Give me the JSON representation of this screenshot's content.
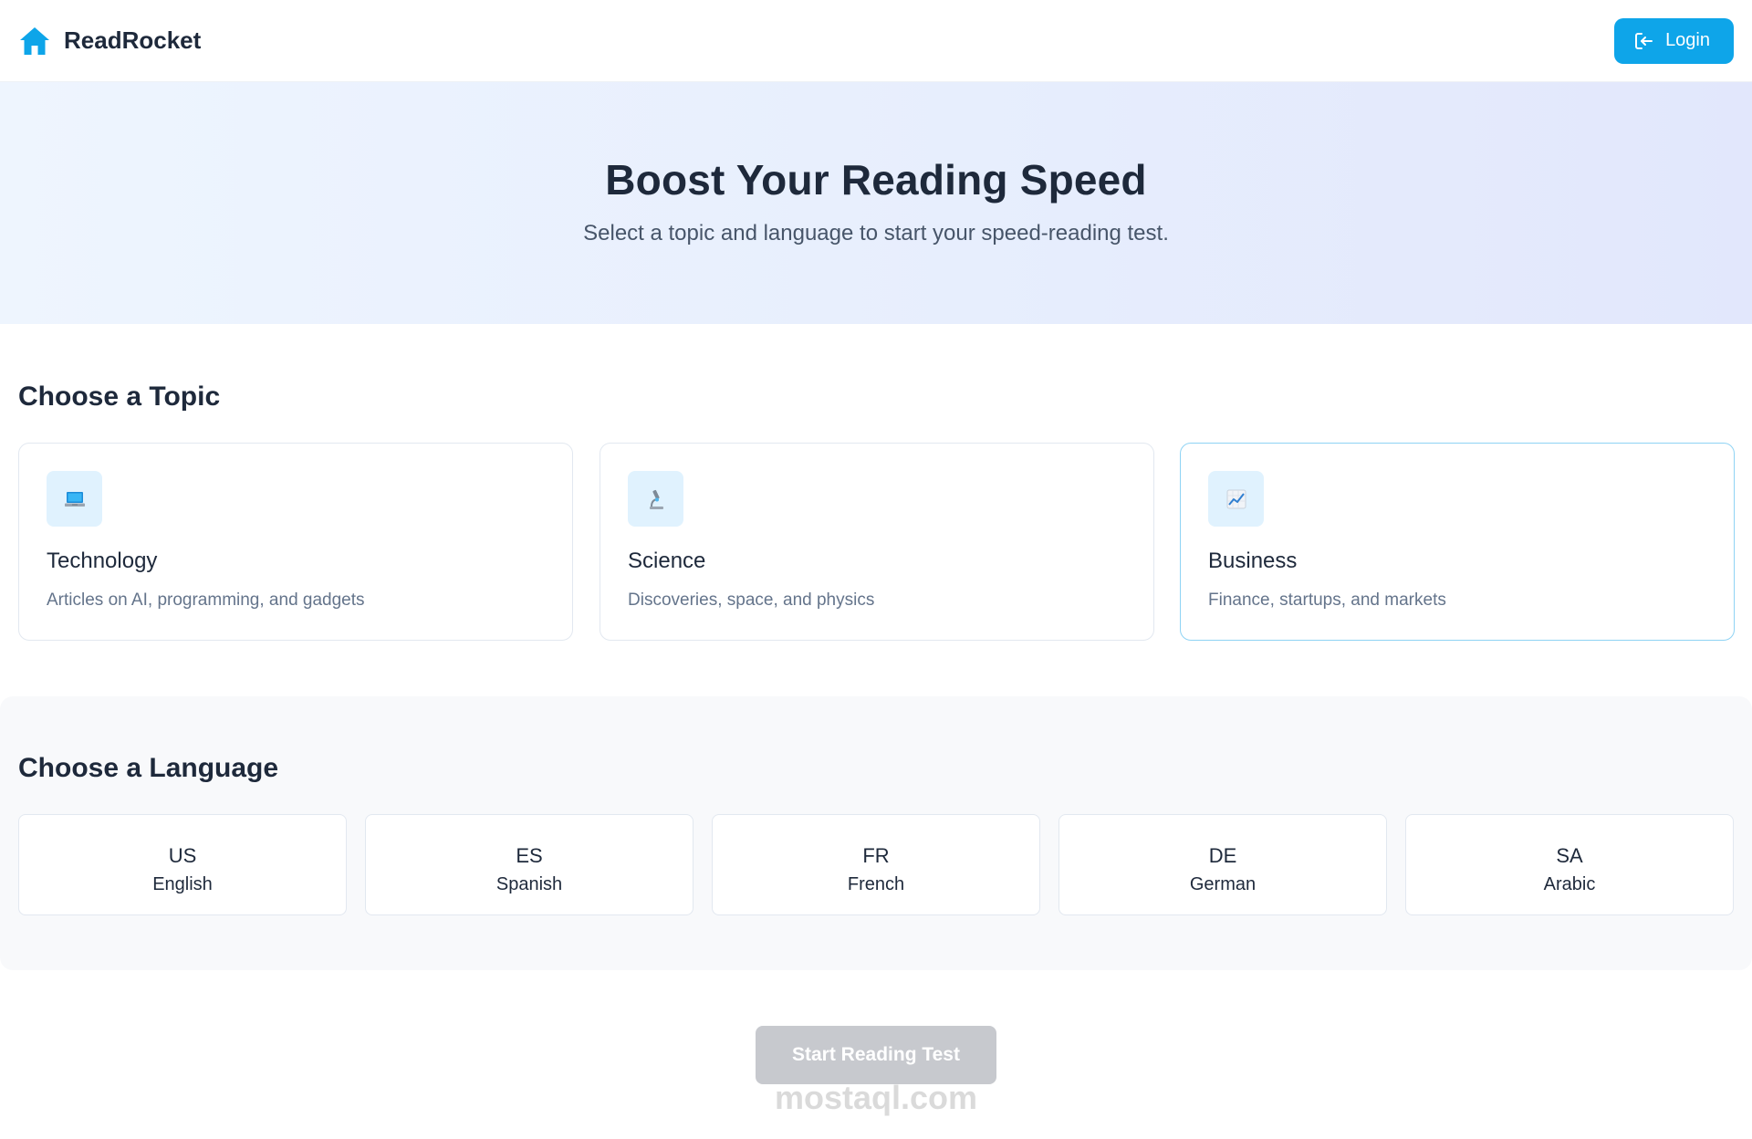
{
  "header": {
    "brand_name": "ReadRocket",
    "login_label": "Login",
    "icons": {
      "brand": "home-icon",
      "login": "login-icon"
    }
  },
  "hero": {
    "title": "Boost Your Reading Speed",
    "subtitle": "Select a topic and language to start your speed-reading test."
  },
  "topics": {
    "title": "Choose a Topic",
    "selected": "Business",
    "items": [
      {
        "name": "Technology",
        "description": "Articles on AI, programming, and gadgets",
        "icon": "laptop-icon"
      },
      {
        "name": "Science",
        "description": "Discoveries, space, and physics",
        "icon": "microscope-icon"
      },
      {
        "name": "Business",
        "description": "Finance, startups, and markets",
        "icon": "chart-increasing-icon"
      }
    ]
  },
  "languages": {
    "title": "Choose a Language",
    "items": [
      {
        "code": "US",
        "name": "English"
      },
      {
        "code": "ES",
        "name": "Spanish"
      },
      {
        "code": "FR",
        "name": "French"
      },
      {
        "code": "DE",
        "name": "German"
      },
      {
        "code": "SA",
        "name": "Arabic"
      }
    ]
  },
  "actions": {
    "start_label": "Start Reading Test",
    "start_enabled": false
  },
  "watermark": "mostaql.com",
  "colors": {
    "accent": "#0ea5e9",
    "text_dark": "#1e293b",
    "text_muted": "#64748b",
    "icon_bg": "#e0f2fe",
    "disabled_button": "#c7c9ce"
  }
}
